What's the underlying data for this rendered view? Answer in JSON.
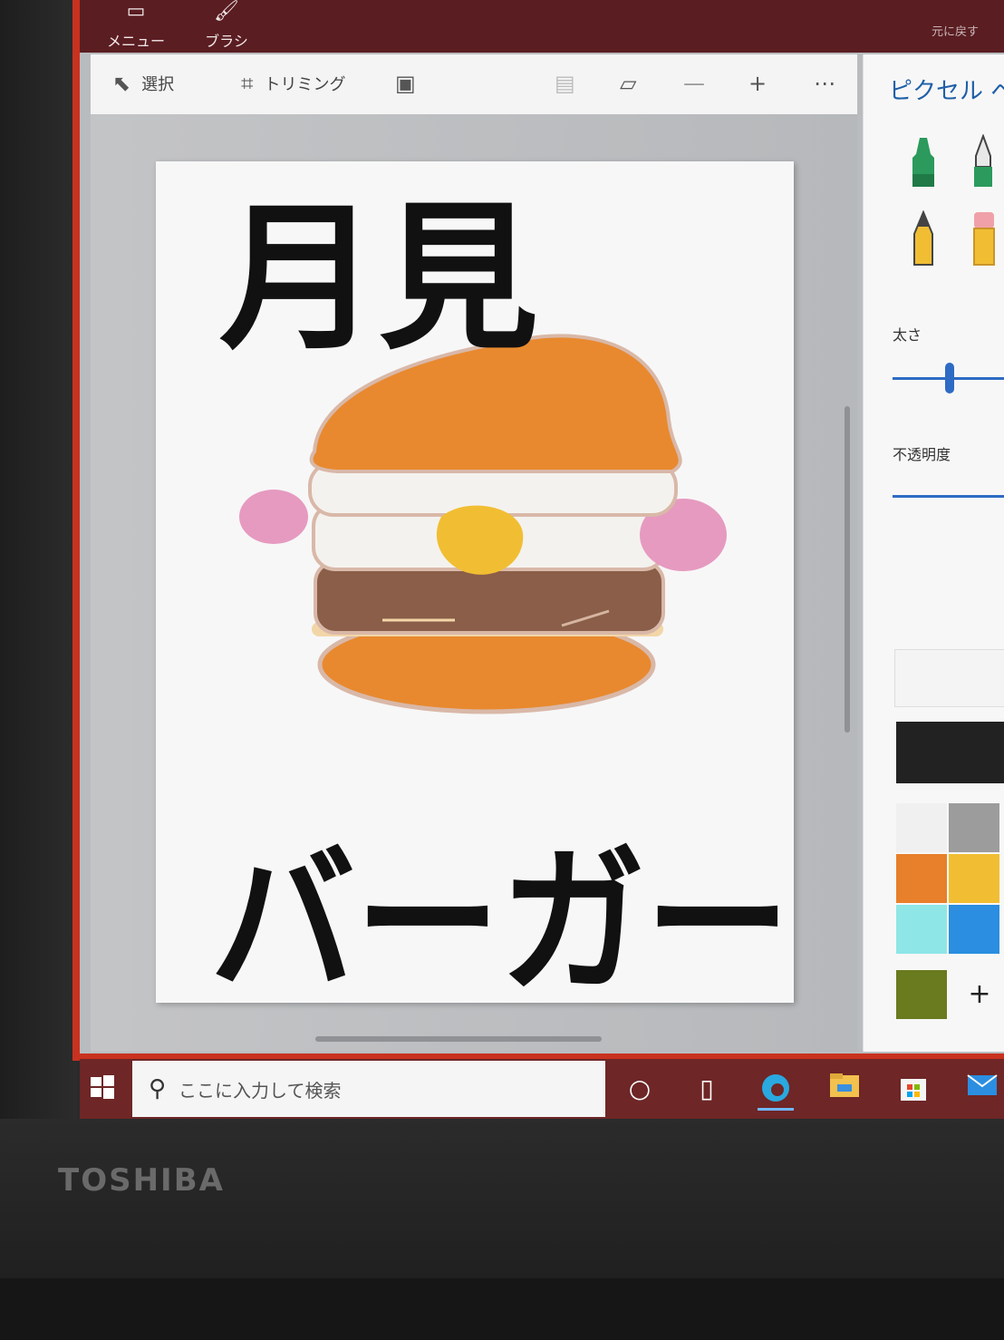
{
  "titlebar": {
    "menu_label": "メニュー",
    "brush_label": "ブラシ",
    "right_label": "元に戻す"
  },
  "toolbar": {
    "select_label": "選択",
    "crop_label": "トリミング"
  },
  "canvas": {
    "top_text": "月見",
    "bottom_text": "バーガー"
  },
  "side_panel": {
    "title": "ピクセル ペン",
    "thickness_label": "太さ",
    "opacity_label": "不透明度",
    "thickness_value": 0.45,
    "opacity_value": 1.0,
    "add_color_label": "+",
    "swatches": [
      "#f0f0f0",
      "#9c9c9c",
      "#e87f2a",
      "#f1be33",
      "#8fe6e6",
      "#2b8ee0",
      "#6a7a1e"
    ]
  },
  "taskbar": {
    "search_placeholder": "ここに入力して検索"
  },
  "device": {
    "brand": "TOSHIBA"
  },
  "colors": {
    "accent": "#2d6bc4",
    "frame_red": "#c8321f",
    "bun_orange": "#e8892f",
    "patty_brown": "#8a5e48",
    "yolk_yellow": "#f1be33",
    "ham_pink": "#e69ac0"
  }
}
